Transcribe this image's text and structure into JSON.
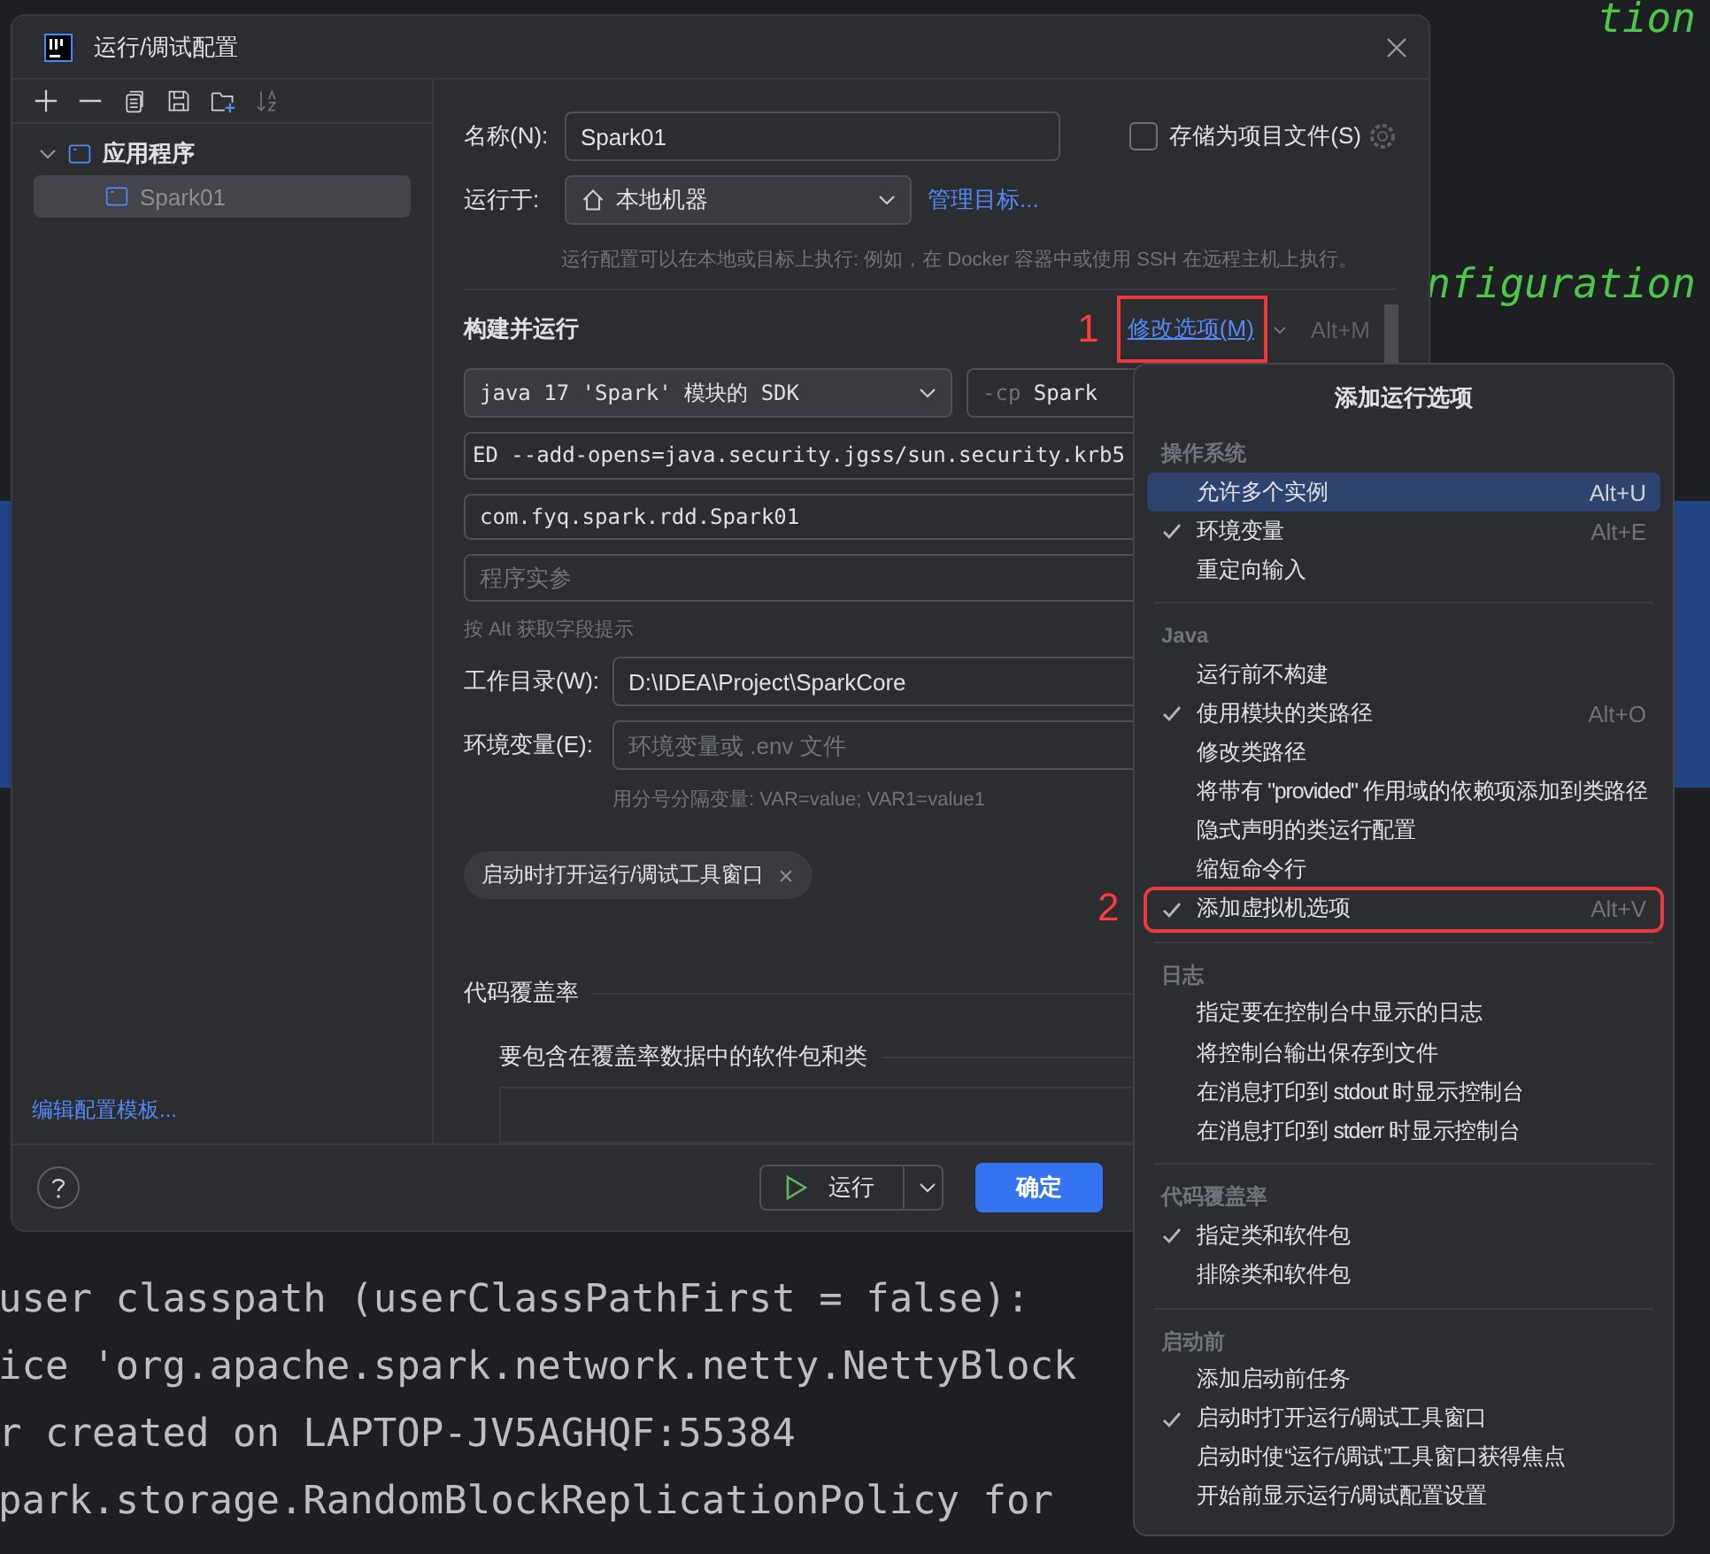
{
  "editor": {
    "fragments": [
      "tion",
      "nfiguration"
    ],
    "console_lines": [
      "user classpath (userClassPathFirst = false):",
      "ice 'org.apache.spark.network.netty.NettyBlock",
      "r created on LAPTOP-JV5AGHQF:55384",
      "park.storage.RandomBlockReplicationPolicy for"
    ]
  },
  "dialog": {
    "title": "运行/调试配置",
    "tree": [
      {
        "label": "应用程序",
        "expanded": true,
        "selected": false,
        "children": [
          {
            "label": "Spark01",
            "selected": true
          }
        ]
      }
    ],
    "edit_templates_link": "编辑配置模板...",
    "name_label": "名称(N):",
    "name_value": "Spark01",
    "store_as_file": {
      "label": "存储为项目文件(S)",
      "checked": false
    },
    "run_on_label": "运行于:",
    "run_on_value": "本地机器",
    "manage_targets_link": "管理目标...",
    "run_on_hint": "运行配置可以在本地或目标上执行: 例如，在 Docker 容器中或使用 SSH 在远程主机上执行。",
    "section_title": "构建并运行",
    "modify_options_link": "修改选项(M)",
    "modify_options_shortcut": "Alt+M",
    "sdk_select": "java 17 'Spark' 模块的 SDK",
    "classpath_prefix": "-cp",
    "classpath_value": "Spark",
    "vm_options_value": "ED   --add-opens=java.security.jgss/sun.security.krb5",
    "main_class_value": "com.fyq.spark.rdd.Spark01",
    "program_args_placeholder": "程序实参",
    "alt_hint": "按 Alt 获取字段提示",
    "workdir_label": "工作目录(W):",
    "workdir_value": "D:\\IDEA\\Project\\SparkCore",
    "env_label": "环境变量(E):",
    "env_placeholder": "环境变量或 .env 文件",
    "env_hint": "用分号分隔变量: VAR=value; VAR1=value1",
    "tags": [
      {
        "label": "启动时打开运行/调试工具窗口"
      }
    ],
    "coverage_title": "代码覆盖率",
    "coverage_subtitle": "要包含在覆盖率数据中的软件包和类",
    "run_button": "运行",
    "ok_button": "确定"
  },
  "annotations": [
    {
      "label": "1"
    }
  ],
  "menu": {
    "title": "添加运行选项",
    "items": [
      {
        "kind": "header",
        "label": "操作系统"
      },
      {
        "kind": "item",
        "label": "允许多个实例",
        "shortcut": "Alt+U",
        "checked": false,
        "selected": true
      },
      {
        "kind": "item",
        "label": "环境变量",
        "shortcut": "Alt+E",
        "checked": true,
        "selected": false
      },
      {
        "kind": "item",
        "label": "重定向输入",
        "checked": false,
        "selected": false
      },
      {
        "kind": "separator"
      },
      {
        "kind": "header",
        "label": "Java"
      },
      {
        "kind": "item",
        "label": "运行前不构建",
        "checked": false,
        "selected": false
      },
      {
        "kind": "item",
        "label": "使用模块的类路径",
        "shortcut": "Alt+O",
        "checked": true,
        "selected": false
      },
      {
        "kind": "item",
        "label": "修改类路径",
        "checked": false,
        "selected": false
      },
      {
        "kind": "item",
        "label": "将带有 \"provided\" 作用域的依赖项添加到类路径",
        "checked": false,
        "selected": false
      },
      {
        "kind": "item",
        "label": "隐式声明的类运行配置",
        "checked": false,
        "selected": false
      },
      {
        "kind": "item",
        "label": "缩短命令行",
        "checked": false,
        "selected": false
      },
      {
        "kind": "item",
        "label": "添加虚拟机选项",
        "shortcut": "Alt+V",
        "checked": true,
        "selected": false,
        "annotation": "2"
      },
      {
        "kind": "separator"
      },
      {
        "kind": "header",
        "label": "日志"
      },
      {
        "kind": "item",
        "label": "指定要在控制台中显示的日志",
        "checked": false,
        "selected": false
      },
      {
        "kind": "item",
        "label": "将控制台输出保存到文件",
        "checked": false,
        "selected": false
      },
      {
        "kind": "item",
        "label": "在消息打印到 stdout 时显示控制台",
        "checked": false,
        "selected": false
      },
      {
        "kind": "item",
        "label": "在消息打印到 stderr 时显示控制台",
        "checked": false,
        "selected": false
      },
      {
        "kind": "separator"
      },
      {
        "kind": "header",
        "label": "代码覆盖率"
      },
      {
        "kind": "item",
        "label": "指定类和软件包",
        "checked": true,
        "selected": false
      },
      {
        "kind": "item",
        "label": "排除类和软件包",
        "checked": false,
        "selected": false
      },
      {
        "kind": "separator"
      },
      {
        "kind": "header",
        "label": "启动前"
      },
      {
        "kind": "item",
        "label": "添加启动前任务",
        "checked": false,
        "selected": false
      },
      {
        "kind": "item",
        "label": "启动时打开运行/调试工具窗口",
        "checked": true,
        "selected": false
      },
      {
        "kind": "item",
        "label": "启动时使“运行/调试”工具窗口获得焦点",
        "checked": false,
        "selected": false
      },
      {
        "kind": "item",
        "label": "开始前显示运行/调试配置设置",
        "checked": false,
        "selected": false
      }
    ]
  }
}
